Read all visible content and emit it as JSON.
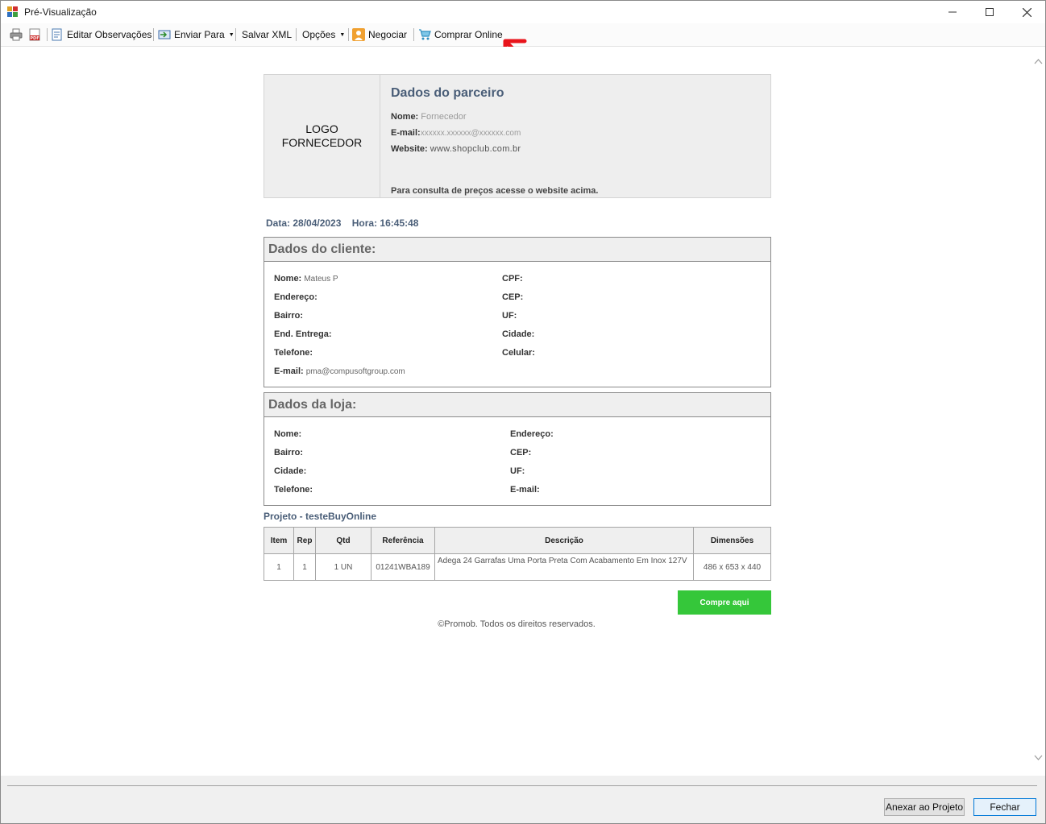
{
  "window": {
    "title": "Pré-Visualização"
  },
  "toolbar": {
    "edit_notes": "Editar Observações",
    "send_to": "Enviar Para",
    "save_xml": "Salvar XML",
    "options": "Opções",
    "negotiate": "Negociar",
    "buy_online": "Comprar Online"
  },
  "partner": {
    "logo_line1": "LOGO",
    "logo_line2": "FORNECEDOR",
    "title": "Dados do parceiro",
    "name_label": "Nome:",
    "name_value": "Fornecedor",
    "email_label": "E-mail:",
    "email_value": "xxxxxx.xxxxxx@xxxxxx.com",
    "website_label": "Website:",
    "website_value": "www.shopclub.com.br",
    "consult": "Para consulta de preços acesse o website acima."
  },
  "meta": {
    "date": "Data: 28/04/2023",
    "time": "Hora: 16:45:48"
  },
  "client": {
    "title": "Dados do cliente:",
    "name_label": "Nome:",
    "name_value": "Mateus P",
    "address_label": "Endereço:",
    "district_label": "Bairro:",
    "delivery_label": "End. Entrega:",
    "phone_label": "Telefone:",
    "email_label": "E-mail:",
    "email_value": "pma@compusoftgroup.com",
    "cpf_label": "CPF:",
    "cep_label": "CEP:",
    "uf_label": "UF:",
    "city_label": "Cidade:",
    "mobile_label": "Celular:"
  },
  "store": {
    "title": "Dados da loja:",
    "name_label": "Nome:",
    "district_label": "Bairro:",
    "city_label": "Cidade:",
    "phone_label": "Telefone:",
    "address_label": "Endereço:",
    "cep_label": "CEP:",
    "uf_label": "UF:",
    "email_label": "E-mail:"
  },
  "project": {
    "title": "Projeto - testeBuyOnline",
    "headers": {
      "item": "Item",
      "rep": "Rep",
      "qtd": "Qtd",
      "ref": "Referência",
      "desc": "Descrição",
      "dim": "Dimensões"
    },
    "rows": [
      {
        "item": "1",
        "rep": "1",
        "qtd": "1 UN",
        "ref": "01241WBA189",
        "desc": "Adega 24 Garrafas Uma Porta Preta Com Acabamento Em Inox 127V",
        "dim": "486 x 653 x 440"
      }
    ]
  },
  "buy_button": "Compre aqui",
  "copyright": "©Promob. Todos os direitos reservados.",
  "footer": {
    "attach": "Anexar ao Projeto",
    "close": "Fechar"
  },
  "colors": {
    "accent_green": "#35c73a",
    "heading_blue": "#4a5e78",
    "annotation_red": "#e8141b"
  }
}
